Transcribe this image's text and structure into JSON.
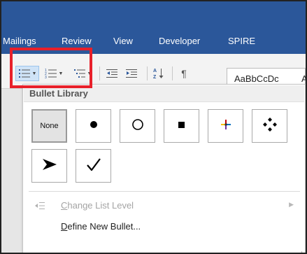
{
  "ribbon": {
    "tabs": [
      "Mailings",
      "Review",
      "View",
      "Developer",
      "SPIRE"
    ]
  },
  "toolbar": {
    "buttons": [
      {
        "name": "bullets-button",
        "icon": "bullets-icon"
      },
      {
        "name": "numbering-button",
        "icon": "numbering-icon"
      },
      {
        "name": "multilevel-list-button",
        "icon": "multilevel-list-icon"
      },
      {
        "name": "decrease-indent-button",
        "icon": "decrease-indent-icon"
      },
      {
        "name": "increase-indent-button",
        "icon": "increase-indent-icon"
      },
      {
        "name": "sort-button",
        "icon": "sort-icon"
      },
      {
        "name": "show-formatting-button",
        "icon": "pilcrow-icon"
      }
    ],
    "styles_preview": "AaBbCcDc",
    "styles_preview_cut": "A"
  },
  "bullet_library": {
    "title": "Bullet Library",
    "items": [
      {
        "label": "None",
        "icon": "none",
        "selected": true
      },
      {
        "label": "",
        "icon": "filled-circle-bullet-icon"
      },
      {
        "label": "",
        "icon": "hollow-circle-bullet-icon"
      },
      {
        "label": "",
        "icon": "filled-square-bullet-icon"
      },
      {
        "label": "",
        "icon": "cross-star-bullet-icon"
      },
      {
        "label": "",
        "icon": "four-diamond-bullet-icon"
      },
      {
        "label": "",
        "icon": "arrowhead-bullet-icon"
      },
      {
        "label": "",
        "icon": "checkmark-bullet-icon"
      }
    ],
    "menu": [
      {
        "label_underlined": "C",
        "label_rest": "hange List Level",
        "enabled": false,
        "has_submenu": true,
        "icon": "change-list-level-icon"
      },
      {
        "label_underlined": "D",
        "label_rest": "efine New Bullet...",
        "enabled": true,
        "has_submenu": false,
        "icon": ""
      }
    ]
  },
  "colors": {
    "ribbon_blue": "#2b579a",
    "highlight_red": "#e8202a"
  }
}
